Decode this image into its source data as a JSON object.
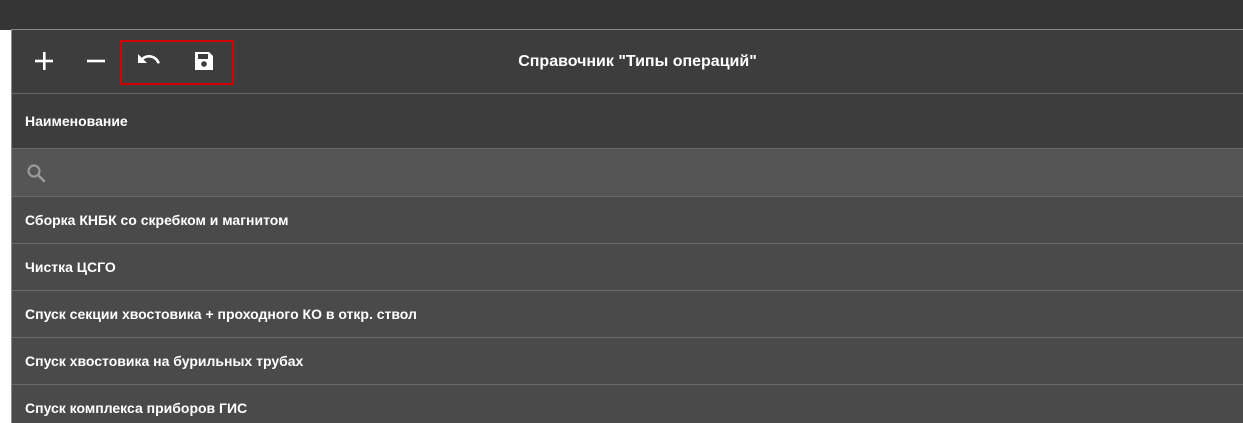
{
  "toolbar": {
    "add_icon": "plus-icon",
    "remove_icon": "minus-icon",
    "undo_icon": "undo-icon",
    "save_icon": "save-icon",
    "title": "Справочник \"Типы операций\""
  },
  "table": {
    "column_header": "Наименование",
    "search_icon": "search-icon",
    "search_value": "",
    "search_placeholder": "",
    "rows": [
      "Сборка КНБК со скребком и магнитом",
      "Чистка ЦСГО",
      "Спуск секции хвостовика + проходного КО в откр. ствол",
      "Спуск хвостовика на бурильных трубах",
      "Спуск комплекса приборов ГИС"
    ]
  },
  "colors": {
    "highlight": "#d40000",
    "panel_bg": "#4a4a4a",
    "header_bg": "#3e3d3d",
    "text": "#ffffff"
  }
}
